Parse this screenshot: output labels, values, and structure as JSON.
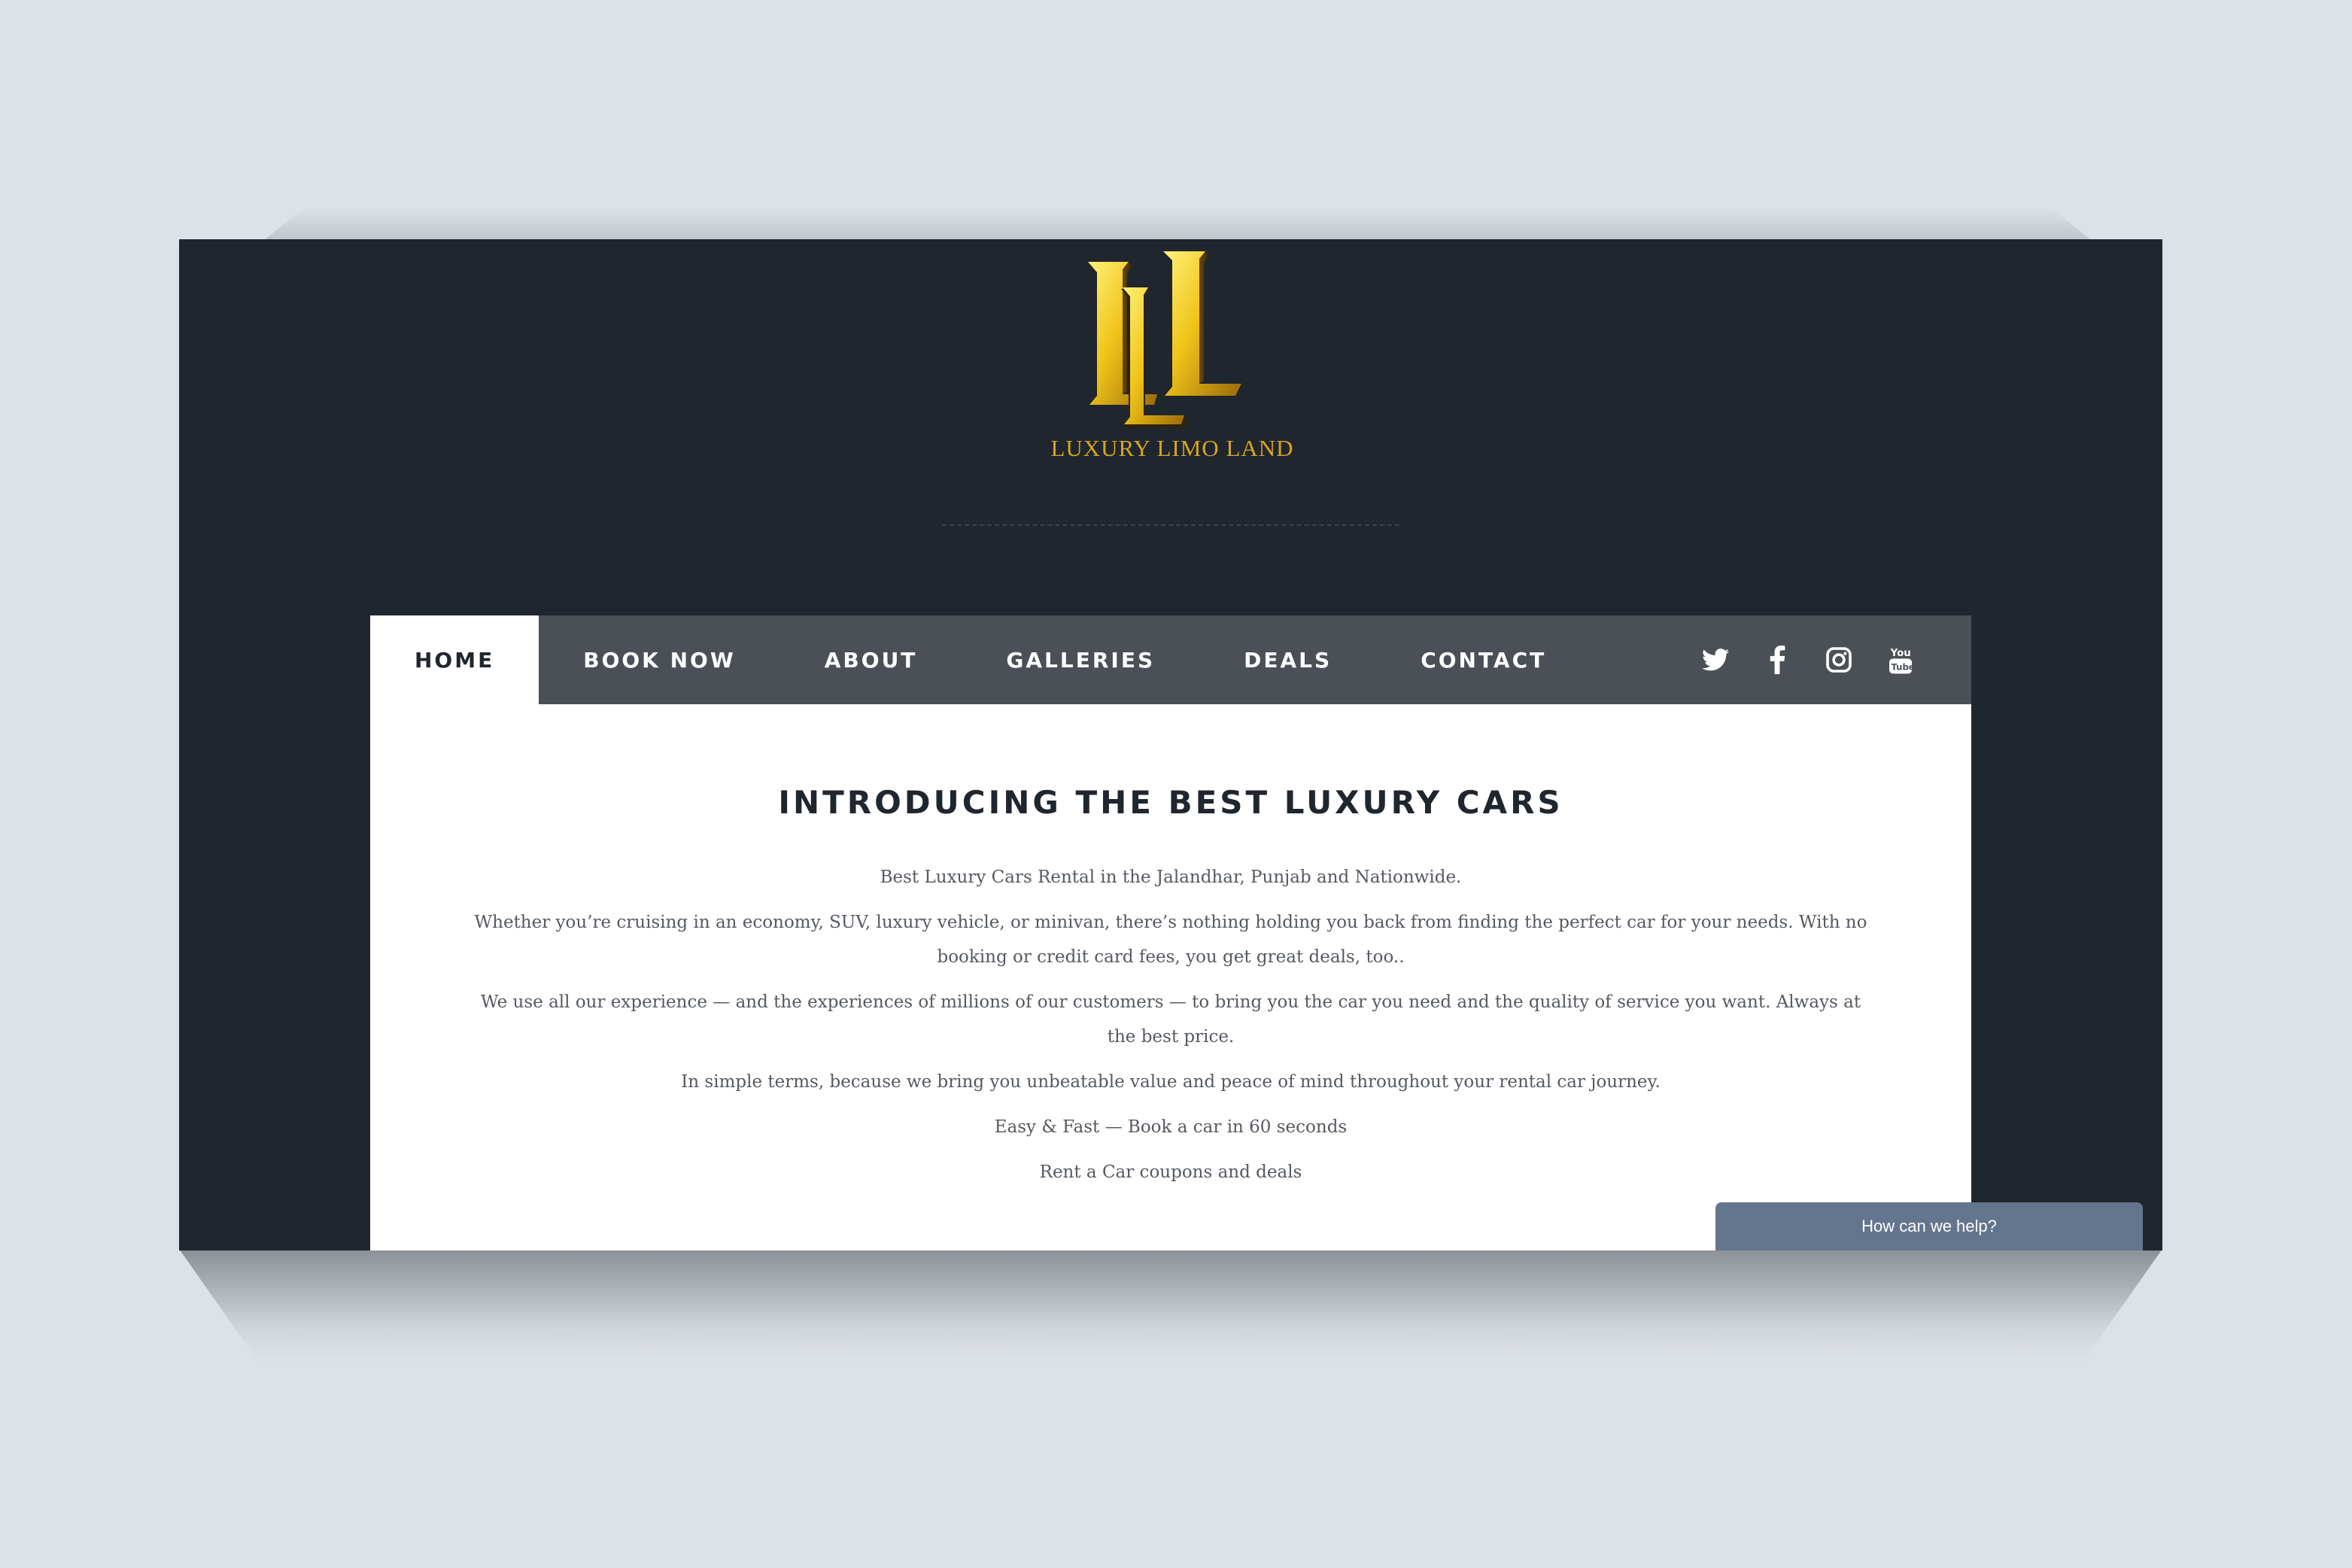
{
  "brand": {
    "logo_text": "LUXURY LIMO LAND",
    "logo_color": "#d9a520"
  },
  "nav": {
    "items": [
      {
        "label": "HOME",
        "active": true
      },
      {
        "label": "BOOK NOW",
        "active": false
      },
      {
        "label": "ABOUT",
        "active": false
      },
      {
        "label": "GALLERIES",
        "active": false
      },
      {
        "label": "DEALS",
        "active": false
      },
      {
        "label": "CONTACT",
        "active": false
      }
    ],
    "social": [
      "twitter-icon",
      "facebook-icon",
      "instagram-icon",
      "youtube-icon"
    ]
  },
  "main": {
    "headline": "INTRODUCING THE BEST LUXURY CARS",
    "paragraphs": [
      "Best Luxury Cars Rental in the Jalandhar, Punjab and Nationwide.",
      "Whether you’re cruising in an economy, SUV, luxury vehicle, or minivan, there’s nothing holding you back from finding the perfect car for your needs. With no booking or credit card fees, you get great deals, too..",
      "We use all our experience — and the experiences of millions of our customers — to bring you the car you need and the quality of service you want. Always at the best price.",
      "In simple terms, because we bring you unbeatable value and peace of mind throughout your rental car journey.",
      "Easy & Fast — Book a car in 60 seconds",
      "Rent a Car coupons and deals"
    ]
  },
  "chat": {
    "label": "How can we help?"
  },
  "colors": {
    "header_bg": "#20262e",
    "nav_bg": "#4b4f56",
    "chat_bg": "#64758e"
  }
}
